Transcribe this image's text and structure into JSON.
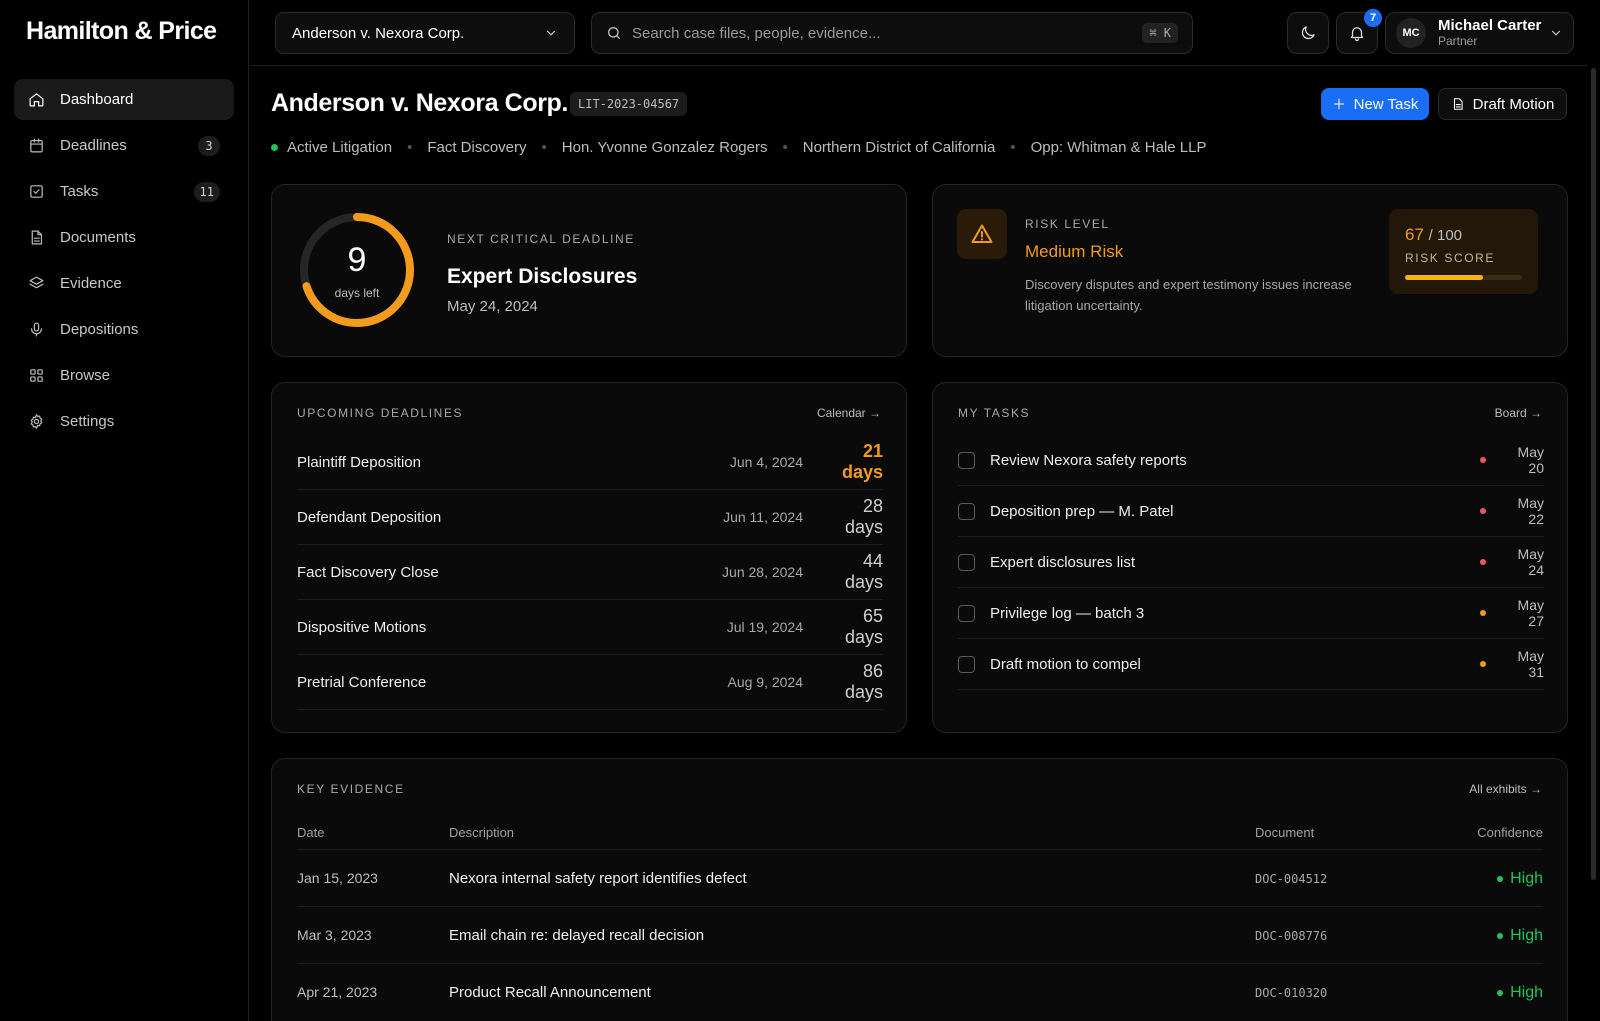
{
  "brand": {
    "logo": "Hamilton & Price"
  },
  "sidebar": {
    "items": [
      {
        "label": "Dashboard",
        "icon": "home-icon",
        "active": true
      },
      {
        "label": "Deadlines",
        "icon": "calendar-icon",
        "badge": "3"
      },
      {
        "label": "Tasks",
        "icon": "checkbox-icon",
        "badge": "11"
      },
      {
        "label": "Documents",
        "icon": "document-icon"
      },
      {
        "label": "Evidence",
        "icon": "layers-icon"
      },
      {
        "label": "Depositions",
        "icon": "microphone-icon"
      },
      {
        "label": "Browse",
        "icon": "grid-icon"
      },
      {
        "label": "Settings",
        "icon": "gear-icon"
      }
    ]
  },
  "topbar": {
    "case_select": "Anderson v. Nexora Corp.",
    "search_placeholder": "Search case files, people, evidence...",
    "search_shortcut": "⌘ K",
    "notification_count": "7",
    "user": {
      "initials": "MC",
      "name": "Michael Carter",
      "role": "Partner"
    }
  },
  "header": {
    "title": "Anderson v. Nexora Corp.",
    "case_id": "LIT-2023-04567",
    "new_task_label": "New Task",
    "draft_motion_label": "Draft Motion",
    "meta": [
      "Active Litigation",
      "Fact Discovery",
      "Hon. Yvonne Gonzalez Rogers",
      "Northern District of California",
      "Opp: Whitman & Hale LLP"
    ]
  },
  "next_deadline": {
    "days": "9",
    "days_label": "days left",
    "progress_fraction": 0.7,
    "label": "NEXT CRITICAL DEADLINE",
    "title": "Expert Disclosures",
    "date": "May 24, 2024",
    "ring_color": "#f29b1d"
  },
  "risk": {
    "label": "RISK LEVEL",
    "level": "Medium Risk",
    "description": "Discovery disputes and expert testimony issues increase litigation uncertainty.",
    "score": "67",
    "score_max": "/ 100",
    "score_label": "RISK SCORE",
    "score_fraction": 0.67,
    "color": "#f29b1d"
  },
  "deadlines": {
    "label": "UPCOMING DEADLINES",
    "link": "Calendar →",
    "rows": [
      {
        "name": "Plaintiff Deposition",
        "date": "Jun 4, 2024",
        "countdown": "21 days",
        "urgent": true
      },
      {
        "name": "Defendant Deposition",
        "date": "Jun 11, 2024",
        "countdown": "28 days"
      },
      {
        "name": "Fact Discovery Close",
        "date": "Jun 28, 2024",
        "countdown": "44 days"
      },
      {
        "name": "Dispositive Motions",
        "date": "Jul 19, 2024",
        "countdown": "65 days"
      },
      {
        "name": "Pretrial Conference",
        "date": "Aug 9, 2024",
        "countdown": "86 days"
      }
    ]
  },
  "tasks": {
    "label": "MY TASKS",
    "link": "Board →",
    "rows": [
      {
        "title": "Review Nexora safety reports",
        "due": "May 20",
        "priority_color": "#f0555a"
      },
      {
        "title": "Deposition prep — M. Patel",
        "due": "May 22",
        "priority_color": "#f0555a"
      },
      {
        "title": "Expert disclosures list",
        "due": "May 24",
        "priority_color": "#f0555a"
      },
      {
        "title": "Privilege log — batch 3",
        "due": "May 27",
        "priority_color": "#f29b1d"
      },
      {
        "title": "Draft motion to compel",
        "due": "May 31",
        "priority_color": "#f29b1d"
      }
    ]
  },
  "evidence": {
    "label": "KEY EVIDENCE",
    "link": "All exhibits →",
    "columns": {
      "date": "Date",
      "description": "Description",
      "document": "Document",
      "confidence": "Confidence"
    },
    "rows": [
      {
        "date": "Jan 15, 2023",
        "description": "Nexora internal safety report identifies defect",
        "document": "DOC-004512",
        "confidence": "High"
      },
      {
        "date": "Mar 3, 2023",
        "description": "Email chain re: delayed recall decision",
        "document": "DOC-008776",
        "confidence": "High"
      },
      {
        "date": "Apr 21, 2023",
        "description": "Product Recall Announcement",
        "document": "DOC-010320",
        "confidence": "High"
      }
    ]
  }
}
